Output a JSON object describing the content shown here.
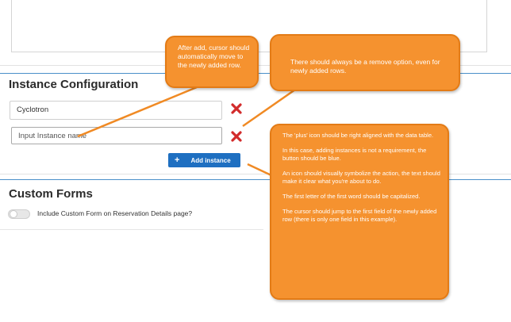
{
  "instance_configuration": {
    "title": "Instance Configuration",
    "rows": [
      {
        "value": "Cyclotron"
      }
    ],
    "new_row_placeholder": "Input Instance name",
    "add_button_label": "Add instance",
    "add_button_icon": "+",
    "remove_icon_color": "#d22b2b"
  },
  "custom_forms": {
    "title": "Custom Forms",
    "toggle_label": "Include Custom Form on Reservation Details page?"
  },
  "annotations": [
    {
      "lines": [
        "After add, cursor should automatically move to the newly added row."
      ]
    },
    {
      "lines": [
        "There should always be a remove option, even for newly added rows."
      ]
    },
    {
      "lines": [
        "The 'plus' icon should be right aligned with the data table.",
        "In this case, adding instances is not a requirement, the button should be blue.",
        "An icon should visually symbolize the action, the text should make it clear what you're about to do.",
        "The first letter of the first word should be capitalized.",
        "The cursor should jump to the first field of the newly added row (there is only one field in this example)."
      ]
    }
  ],
  "colors": {
    "accent_blue": "#1e6fc1",
    "callout_orange": "#f5922f",
    "remove_red": "#d22b2b"
  }
}
